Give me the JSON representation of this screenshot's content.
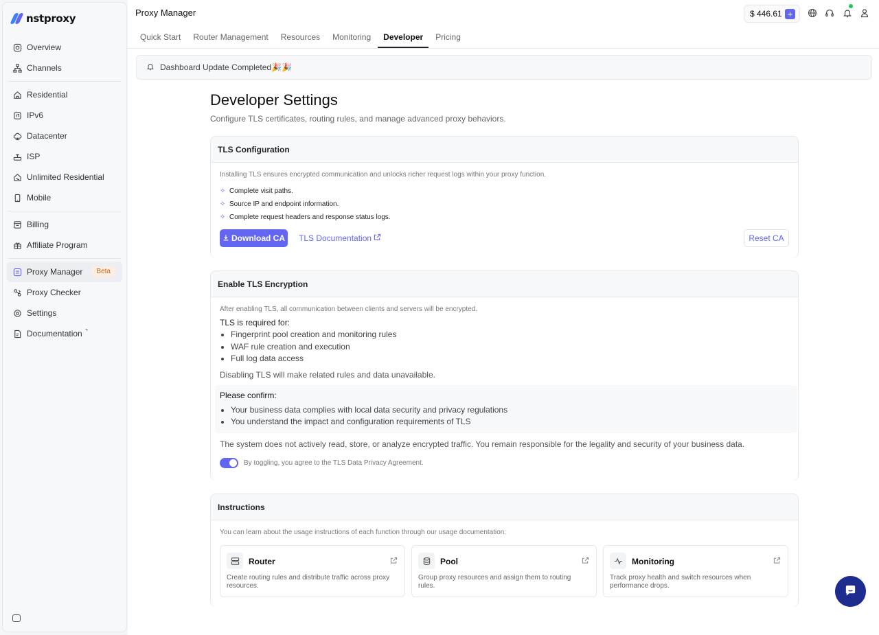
{
  "brand": {
    "name": "nstproxy"
  },
  "sidebar": {
    "items": [
      {
        "label": "Overview",
        "icon": "compass-icon"
      },
      {
        "label": "Channels",
        "icon": "network-icon"
      },
      {
        "label": "Residential",
        "icon": "home-icon"
      },
      {
        "label": "IPv6",
        "icon": "ipv6-icon"
      },
      {
        "label": "Datacenter",
        "icon": "cloud-icon"
      },
      {
        "label": "ISP",
        "icon": "router-icon"
      },
      {
        "label": "Unlimited Residential",
        "icon": "infinity-home-icon"
      },
      {
        "label": "Mobile",
        "icon": "mobile-icon"
      },
      {
        "label": "Billing",
        "icon": "billing-icon"
      },
      {
        "label": "Affiliate Program",
        "icon": "gift-icon"
      },
      {
        "label": "Proxy Manager",
        "icon": "proxy-manager-icon",
        "badge": "Beta"
      },
      {
        "label": "Proxy Checker",
        "icon": "checker-icon"
      },
      {
        "label": "Settings",
        "icon": "gear-icon"
      },
      {
        "label": "Documentation",
        "icon": "document-icon"
      }
    ]
  },
  "header": {
    "title": "Proxy Manager",
    "balance": "$ 446.61",
    "tabs": [
      "Quick Start",
      "Router Management",
      "Resources",
      "Monitoring",
      "Developer",
      "Pricing"
    ],
    "active_tab": "Developer"
  },
  "banner": {
    "text": "Dashboard Update Completed🎉🎉"
  },
  "page": {
    "title": "Developer Settings",
    "subtitle": "Configure TLS certificates, routing rules, and manage advanced proxy behaviors."
  },
  "tls_config": {
    "title": "TLS Configuration",
    "description": "Installing TLS ensures encrypted communication and unlocks richer request logs within your proxy function.",
    "features": [
      "Complete visit paths.",
      "Source IP and endpoint information.",
      "Complete request headers and response status logs."
    ],
    "download_label": "Download CA",
    "docs_label": "TLS Documentation",
    "reset_label": "Reset CA"
  },
  "tls_encryption": {
    "title": "Enable TLS Encryption",
    "description": "After enabling TLS, all communication between clients and servers will be encrypted.",
    "required_title": "TLS is required for:",
    "required_items": [
      "Fingerprint pool creation and monitoring rules",
      "WAF rule creation and execution",
      "Full log data access"
    ],
    "disable_note": "Disabling TLS will make related rules and data unavailable.",
    "confirm_title": "Please confirm:",
    "confirm_items": [
      "Your business data complies with local data security and privacy regulations",
      "You understand the impact and configuration requirements of TLS"
    ],
    "responsibility": "The system does not actively read, store, or analyze encrypted traffic. You remain responsible for the legality and security of your business data.",
    "toggle_on": true,
    "toggle_label": "By toggling, you agree to the TLS Data Privacy Agreement."
  },
  "instructions": {
    "title": "Instructions",
    "description": "You can learn about the usage instructions of each function through our usage documentation:",
    "cards": [
      {
        "name": "Router",
        "desc": "Create routing rules and distribute traffic across proxy resources.",
        "icon": "server-icon"
      },
      {
        "name": "Pool",
        "desc": "Group proxy resources and assign them to routing rules.",
        "icon": "database-icon"
      },
      {
        "name": "Monitoring",
        "desc": "Track proxy health and switch resources when performance drops.",
        "icon": "pulse-icon"
      }
    ]
  },
  "colors": {
    "accent": "#6366f1",
    "chat_button": "#1e2b8f",
    "status_dot": "#22c55e",
    "beta_text": "#c0651f"
  }
}
